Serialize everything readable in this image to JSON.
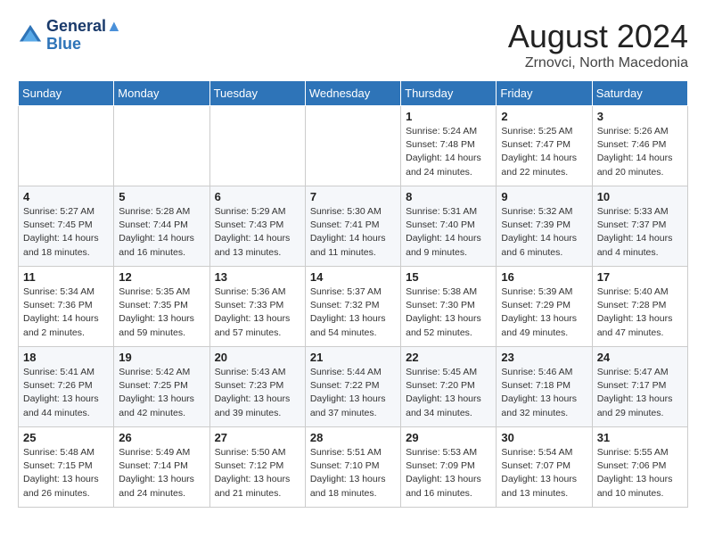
{
  "header": {
    "logo_line1": "General",
    "logo_line2": "Blue",
    "month_year": "August 2024",
    "location": "Zrnovci, North Macedonia"
  },
  "weekdays": [
    "Sunday",
    "Monday",
    "Tuesday",
    "Wednesday",
    "Thursday",
    "Friday",
    "Saturday"
  ],
  "weeks": [
    [
      {
        "day": "",
        "info": ""
      },
      {
        "day": "",
        "info": ""
      },
      {
        "day": "",
        "info": ""
      },
      {
        "day": "",
        "info": ""
      },
      {
        "day": "1",
        "info": "Sunrise: 5:24 AM\nSunset: 7:48 PM\nDaylight: 14 hours\nand 24 minutes."
      },
      {
        "day": "2",
        "info": "Sunrise: 5:25 AM\nSunset: 7:47 PM\nDaylight: 14 hours\nand 22 minutes."
      },
      {
        "day": "3",
        "info": "Sunrise: 5:26 AM\nSunset: 7:46 PM\nDaylight: 14 hours\nand 20 minutes."
      }
    ],
    [
      {
        "day": "4",
        "info": "Sunrise: 5:27 AM\nSunset: 7:45 PM\nDaylight: 14 hours\nand 18 minutes."
      },
      {
        "day": "5",
        "info": "Sunrise: 5:28 AM\nSunset: 7:44 PM\nDaylight: 14 hours\nand 16 minutes."
      },
      {
        "day": "6",
        "info": "Sunrise: 5:29 AM\nSunset: 7:43 PM\nDaylight: 14 hours\nand 13 minutes."
      },
      {
        "day": "7",
        "info": "Sunrise: 5:30 AM\nSunset: 7:41 PM\nDaylight: 14 hours\nand 11 minutes."
      },
      {
        "day": "8",
        "info": "Sunrise: 5:31 AM\nSunset: 7:40 PM\nDaylight: 14 hours\nand 9 minutes."
      },
      {
        "day": "9",
        "info": "Sunrise: 5:32 AM\nSunset: 7:39 PM\nDaylight: 14 hours\nand 6 minutes."
      },
      {
        "day": "10",
        "info": "Sunrise: 5:33 AM\nSunset: 7:37 PM\nDaylight: 14 hours\nand 4 minutes."
      }
    ],
    [
      {
        "day": "11",
        "info": "Sunrise: 5:34 AM\nSunset: 7:36 PM\nDaylight: 14 hours\nand 2 minutes."
      },
      {
        "day": "12",
        "info": "Sunrise: 5:35 AM\nSunset: 7:35 PM\nDaylight: 13 hours\nand 59 minutes."
      },
      {
        "day": "13",
        "info": "Sunrise: 5:36 AM\nSunset: 7:33 PM\nDaylight: 13 hours\nand 57 minutes."
      },
      {
        "day": "14",
        "info": "Sunrise: 5:37 AM\nSunset: 7:32 PM\nDaylight: 13 hours\nand 54 minutes."
      },
      {
        "day": "15",
        "info": "Sunrise: 5:38 AM\nSunset: 7:30 PM\nDaylight: 13 hours\nand 52 minutes."
      },
      {
        "day": "16",
        "info": "Sunrise: 5:39 AM\nSunset: 7:29 PM\nDaylight: 13 hours\nand 49 minutes."
      },
      {
        "day": "17",
        "info": "Sunrise: 5:40 AM\nSunset: 7:28 PM\nDaylight: 13 hours\nand 47 minutes."
      }
    ],
    [
      {
        "day": "18",
        "info": "Sunrise: 5:41 AM\nSunset: 7:26 PM\nDaylight: 13 hours\nand 44 minutes."
      },
      {
        "day": "19",
        "info": "Sunrise: 5:42 AM\nSunset: 7:25 PM\nDaylight: 13 hours\nand 42 minutes."
      },
      {
        "day": "20",
        "info": "Sunrise: 5:43 AM\nSunset: 7:23 PM\nDaylight: 13 hours\nand 39 minutes."
      },
      {
        "day": "21",
        "info": "Sunrise: 5:44 AM\nSunset: 7:22 PM\nDaylight: 13 hours\nand 37 minutes."
      },
      {
        "day": "22",
        "info": "Sunrise: 5:45 AM\nSunset: 7:20 PM\nDaylight: 13 hours\nand 34 minutes."
      },
      {
        "day": "23",
        "info": "Sunrise: 5:46 AM\nSunset: 7:18 PM\nDaylight: 13 hours\nand 32 minutes."
      },
      {
        "day": "24",
        "info": "Sunrise: 5:47 AM\nSunset: 7:17 PM\nDaylight: 13 hours\nand 29 minutes."
      }
    ],
    [
      {
        "day": "25",
        "info": "Sunrise: 5:48 AM\nSunset: 7:15 PM\nDaylight: 13 hours\nand 26 minutes."
      },
      {
        "day": "26",
        "info": "Sunrise: 5:49 AM\nSunset: 7:14 PM\nDaylight: 13 hours\nand 24 minutes."
      },
      {
        "day": "27",
        "info": "Sunrise: 5:50 AM\nSunset: 7:12 PM\nDaylight: 13 hours\nand 21 minutes."
      },
      {
        "day": "28",
        "info": "Sunrise: 5:51 AM\nSunset: 7:10 PM\nDaylight: 13 hours\nand 18 minutes."
      },
      {
        "day": "29",
        "info": "Sunrise: 5:53 AM\nSunset: 7:09 PM\nDaylight: 13 hours\nand 16 minutes."
      },
      {
        "day": "30",
        "info": "Sunrise: 5:54 AM\nSunset: 7:07 PM\nDaylight: 13 hours\nand 13 minutes."
      },
      {
        "day": "31",
        "info": "Sunrise: 5:55 AM\nSunset: 7:06 PM\nDaylight: 13 hours\nand 10 minutes."
      }
    ]
  ]
}
